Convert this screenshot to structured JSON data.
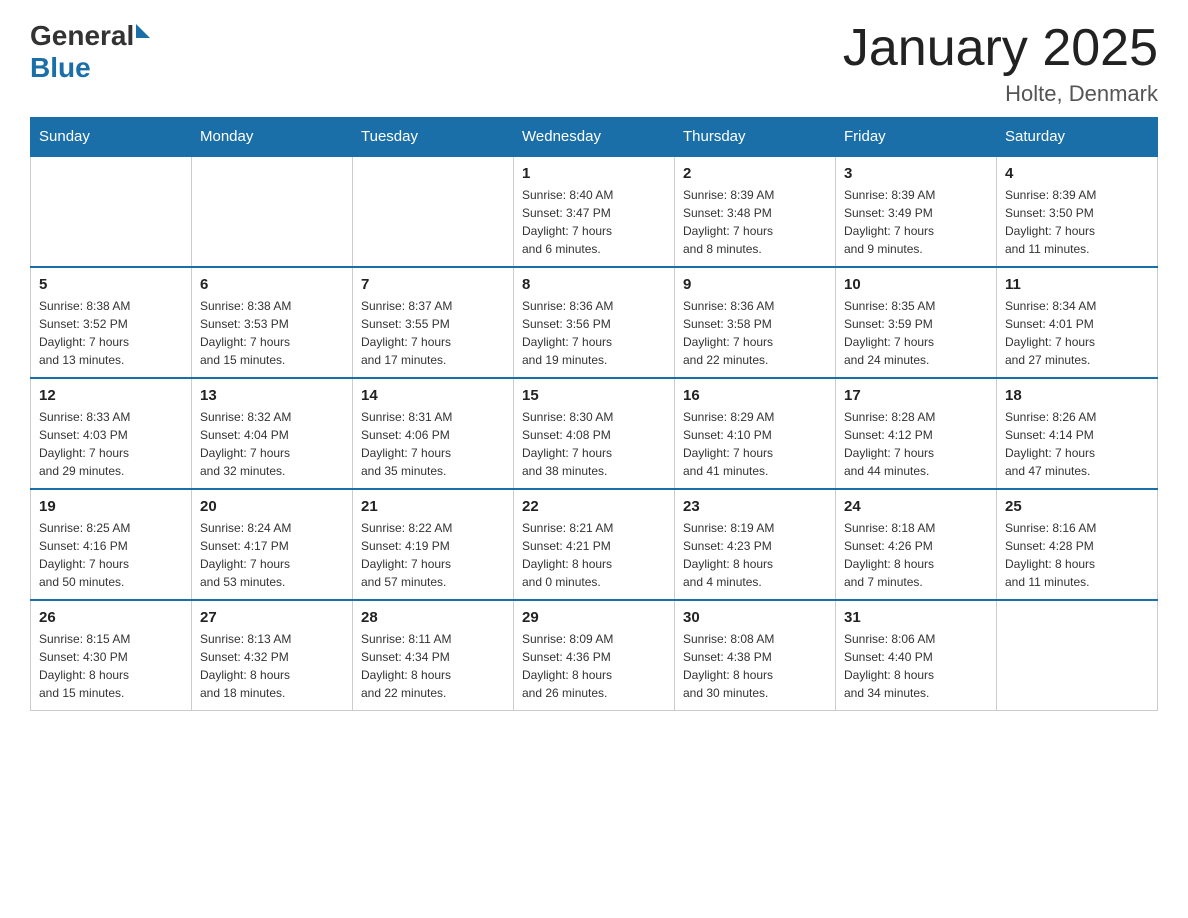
{
  "header": {
    "title": "January 2025",
    "subtitle": "Holte, Denmark",
    "logo_general": "General",
    "logo_blue": "Blue"
  },
  "days_of_week": [
    "Sunday",
    "Monday",
    "Tuesday",
    "Wednesday",
    "Thursday",
    "Friday",
    "Saturday"
  ],
  "weeks": [
    [
      {
        "day": "",
        "info": ""
      },
      {
        "day": "",
        "info": ""
      },
      {
        "day": "",
        "info": ""
      },
      {
        "day": "1",
        "info": "Sunrise: 8:40 AM\nSunset: 3:47 PM\nDaylight: 7 hours\nand 6 minutes."
      },
      {
        "day": "2",
        "info": "Sunrise: 8:39 AM\nSunset: 3:48 PM\nDaylight: 7 hours\nand 8 minutes."
      },
      {
        "day": "3",
        "info": "Sunrise: 8:39 AM\nSunset: 3:49 PM\nDaylight: 7 hours\nand 9 minutes."
      },
      {
        "day": "4",
        "info": "Sunrise: 8:39 AM\nSunset: 3:50 PM\nDaylight: 7 hours\nand 11 minutes."
      }
    ],
    [
      {
        "day": "5",
        "info": "Sunrise: 8:38 AM\nSunset: 3:52 PM\nDaylight: 7 hours\nand 13 minutes."
      },
      {
        "day": "6",
        "info": "Sunrise: 8:38 AM\nSunset: 3:53 PM\nDaylight: 7 hours\nand 15 minutes."
      },
      {
        "day": "7",
        "info": "Sunrise: 8:37 AM\nSunset: 3:55 PM\nDaylight: 7 hours\nand 17 minutes."
      },
      {
        "day": "8",
        "info": "Sunrise: 8:36 AM\nSunset: 3:56 PM\nDaylight: 7 hours\nand 19 minutes."
      },
      {
        "day": "9",
        "info": "Sunrise: 8:36 AM\nSunset: 3:58 PM\nDaylight: 7 hours\nand 22 minutes."
      },
      {
        "day": "10",
        "info": "Sunrise: 8:35 AM\nSunset: 3:59 PM\nDaylight: 7 hours\nand 24 minutes."
      },
      {
        "day": "11",
        "info": "Sunrise: 8:34 AM\nSunset: 4:01 PM\nDaylight: 7 hours\nand 27 minutes."
      }
    ],
    [
      {
        "day": "12",
        "info": "Sunrise: 8:33 AM\nSunset: 4:03 PM\nDaylight: 7 hours\nand 29 minutes."
      },
      {
        "day": "13",
        "info": "Sunrise: 8:32 AM\nSunset: 4:04 PM\nDaylight: 7 hours\nand 32 minutes."
      },
      {
        "day": "14",
        "info": "Sunrise: 8:31 AM\nSunset: 4:06 PM\nDaylight: 7 hours\nand 35 minutes."
      },
      {
        "day": "15",
        "info": "Sunrise: 8:30 AM\nSunset: 4:08 PM\nDaylight: 7 hours\nand 38 minutes."
      },
      {
        "day": "16",
        "info": "Sunrise: 8:29 AM\nSunset: 4:10 PM\nDaylight: 7 hours\nand 41 minutes."
      },
      {
        "day": "17",
        "info": "Sunrise: 8:28 AM\nSunset: 4:12 PM\nDaylight: 7 hours\nand 44 minutes."
      },
      {
        "day": "18",
        "info": "Sunrise: 8:26 AM\nSunset: 4:14 PM\nDaylight: 7 hours\nand 47 minutes."
      }
    ],
    [
      {
        "day": "19",
        "info": "Sunrise: 8:25 AM\nSunset: 4:16 PM\nDaylight: 7 hours\nand 50 minutes."
      },
      {
        "day": "20",
        "info": "Sunrise: 8:24 AM\nSunset: 4:17 PM\nDaylight: 7 hours\nand 53 minutes."
      },
      {
        "day": "21",
        "info": "Sunrise: 8:22 AM\nSunset: 4:19 PM\nDaylight: 7 hours\nand 57 minutes."
      },
      {
        "day": "22",
        "info": "Sunrise: 8:21 AM\nSunset: 4:21 PM\nDaylight: 8 hours\nand 0 minutes."
      },
      {
        "day": "23",
        "info": "Sunrise: 8:19 AM\nSunset: 4:23 PM\nDaylight: 8 hours\nand 4 minutes."
      },
      {
        "day": "24",
        "info": "Sunrise: 8:18 AM\nSunset: 4:26 PM\nDaylight: 8 hours\nand 7 minutes."
      },
      {
        "day": "25",
        "info": "Sunrise: 8:16 AM\nSunset: 4:28 PM\nDaylight: 8 hours\nand 11 minutes."
      }
    ],
    [
      {
        "day": "26",
        "info": "Sunrise: 8:15 AM\nSunset: 4:30 PM\nDaylight: 8 hours\nand 15 minutes."
      },
      {
        "day": "27",
        "info": "Sunrise: 8:13 AM\nSunset: 4:32 PM\nDaylight: 8 hours\nand 18 minutes."
      },
      {
        "day": "28",
        "info": "Sunrise: 8:11 AM\nSunset: 4:34 PM\nDaylight: 8 hours\nand 22 minutes."
      },
      {
        "day": "29",
        "info": "Sunrise: 8:09 AM\nSunset: 4:36 PM\nDaylight: 8 hours\nand 26 minutes."
      },
      {
        "day": "30",
        "info": "Sunrise: 8:08 AM\nSunset: 4:38 PM\nDaylight: 8 hours\nand 30 minutes."
      },
      {
        "day": "31",
        "info": "Sunrise: 8:06 AM\nSunset: 4:40 PM\nDaylight: 8 hours\nand 34 minutes."
      },
      {
        "day": "",
        "info": ""
      }
    ]
  ]
}
